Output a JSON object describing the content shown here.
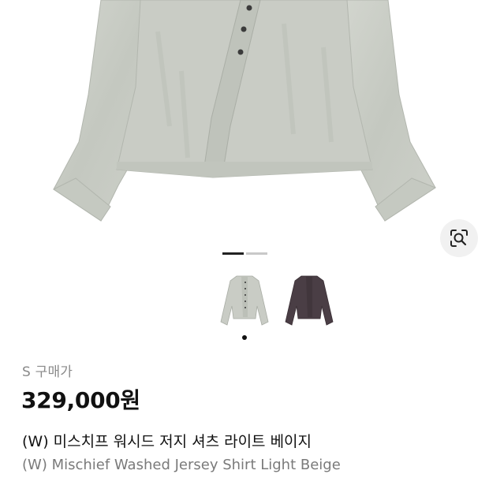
{
  "product": {
    "size_label": "S",
    "price_type_label": "구매가",
    "price": "329,000원",
    "name_ko": "(W) 미스치프 워시드 저지 셔츠 라이트 베이지",
    "name_en": "(W) Mischief Washed Jersey Shirt Light Beige"
  },
  "gallery": {
    "active_slide": 1,
    "slide_count": 2,
    "thumbnails": [
      {
        "variant": "light-beige",
        "selected": true
      },
      {
        "variant": "dark-plum",
        "selected": false
      }
    ]
  },
  "icons": {
    "image_search": "lens-search-icon"
  },
  "colors": {
    "garment_light": "#c9ccc5",
    "garment_dark": "#4a3e45",
    "indicator_active": "#222222",
    "indicator_inactive": "#c8c8c8",
    "secondary_text": "#8a8a8a"
  }
}
